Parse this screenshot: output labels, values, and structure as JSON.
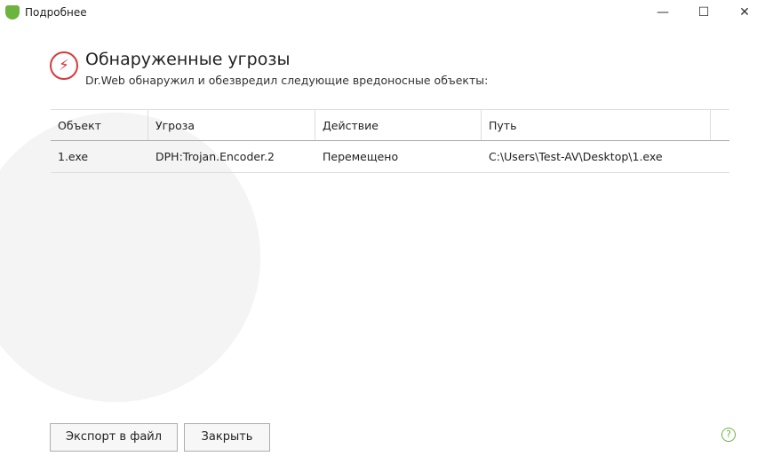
{
  "window": {
    "title": "Подробнее",
    "minimize": "—",
    "maximize": "☐",
    "close": "✕"
  },
  "header": {
    "icon": "lightning-icon",
    "title": "Обнаруженные угрозы",
    "subtitle": "Dr.Web обнаружил и обезвредил следующие вредоносные объекты:"
  },
  "table": {
    "columns": [
      "Объект",
      "Угроза",
      "Действие",
      "Путь"
    ],
    "rows": [
      [
        "1.exe",
        "DPH:Trojan.Encoder.2",
        "Перемещено",
        "C:\\Users\\Test-AV\\Desktop\\1.exe"
      ]
    ]
  },
  "buttons": {
    "export": "Экспорт в файл",
    "close": "Закрыть",
    "help": "?"
  },
  "colors": {
    "accent": "#6db33f",
    "threat": "#d9383a"
  }
}
